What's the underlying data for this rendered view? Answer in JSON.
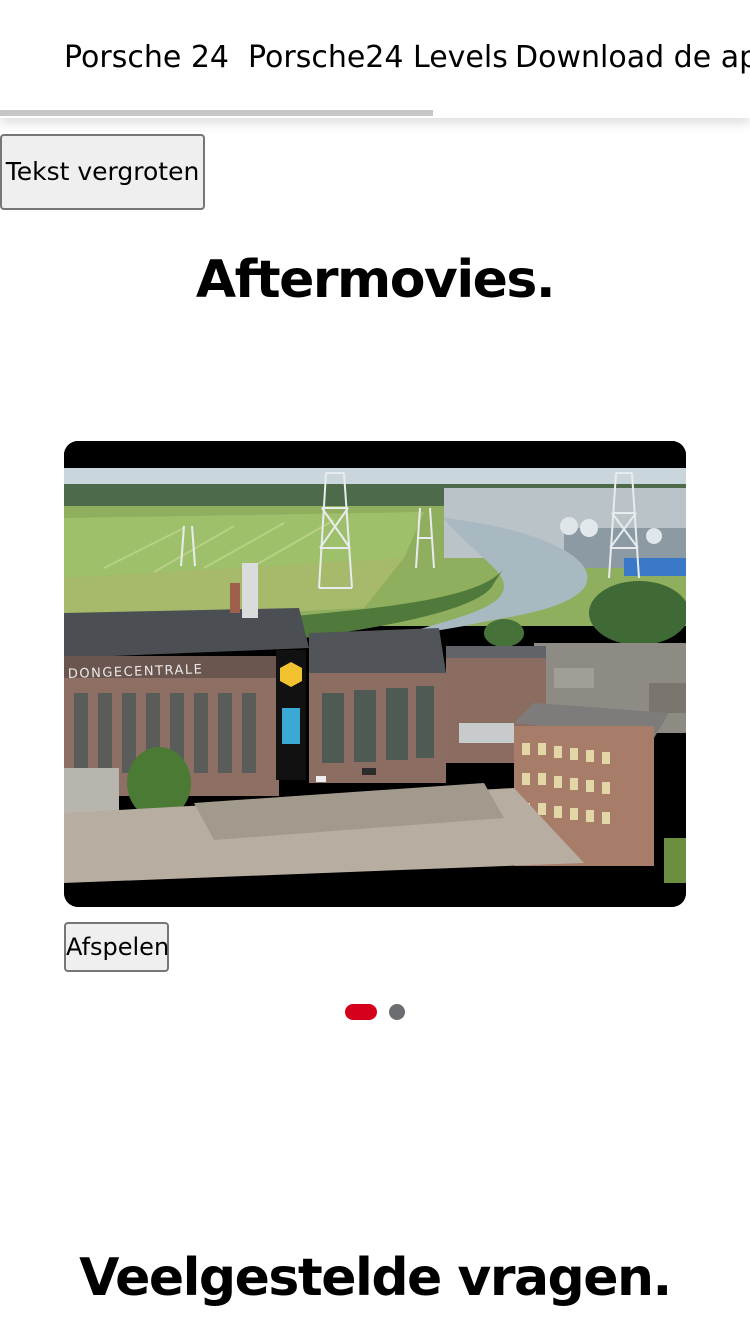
{
  "nav": {
    "tabs": [
      {
        "label": "Porsche 24"
      },
      {
        "label": "Porsche24 Levels"
      },
      {
        "label": "Download de app"
      }
    ],
    "scroll_progress": 0.577
  },
  "accessibility": {
    "enlarge_text_label": "Tekst vergroten"
  },
  "aftermovies": {
    "title": "Aftermovies.",
    "video": {
      "building_sign": "DONGECENTRALE"
    },
    "play_label": "Afspelen",
    "carousel": {
      "slide_count": 2,
      "active_index": 0
    }
  },
  "faq": {
    "title": "Veelgestelde vragen."
  },
  "colors": {
    "accent_red": "#d5001c",
    "dot_inactive": "#6b6d70",
    "scrollbar": "#c7c7c7"
  }
}
